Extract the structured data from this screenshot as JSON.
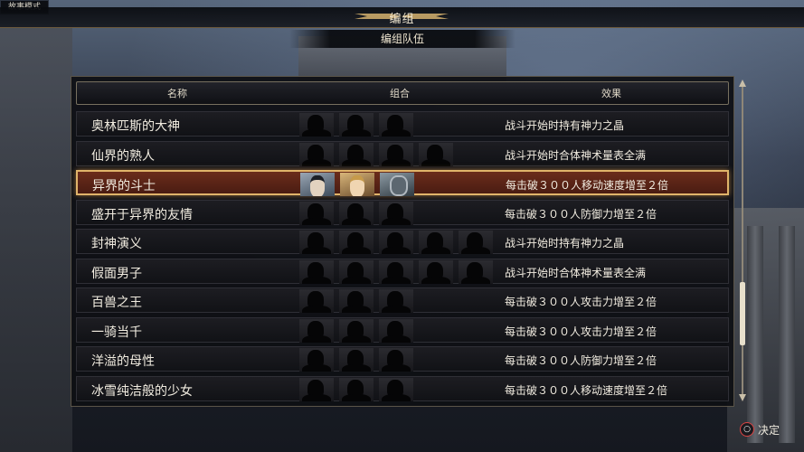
{
  "mode_label": "故事模式",
  "title": "编组",
  "subtitle": "编组队伍",
  "columns": {
    "name": "名称",
    "combo": "组合",
    "effect": "效果"
  },
  "rows": [
    {
      "name": "奥林匹斯的大神",
      "members": 3,
      "effect": "战斗开始时持有神力之晶"
    },
    {
      "name": "仙界的熟人",
      "members": 4,
      "effect": "战斗开始时合体神术量表全满"
    },
    {
      "name": "异界的斗士",
      "members": 3,
      "effect": "每击破３００人移动速度增至２倍",
      "selected": true
    },
    {
      "name": "盛开于异界的友情",
      "members": 3,
      "effect": "每击破３００人防御力增至２倍"
    },
    {
      "name": "封神演义",
      "members": 5,
      "effect": "战斗开始时持有神力之晶"
    },
    {
      "name": "假面男子",
      "members": 5,
      "effect": "战斗开始时合体神术量表全满"
    },
    {
      "name": "百兽之王",
      "members": 3,
      "effect": "每击破３００人攻击力增至２倍"
    },
    {
      "name": "一骑当千",
      "members": 3,
      "effect": "每击破３００人攻击力增至２倍"
    },
    {
      "name": "洋溢的母性",
      "members": 3,
      "effect": "每击破３００人防御力增至２倍"
    },
    {
      "name": "冰雪纯洁般的少女",
      "members": 3,
      "effect": "每击破３００人移动速度增至２倍"
    }
  ],
  "scroll_position": 0.8,
  "confirm": {
    "button": "○",
    "label": "决定"
  },
  "colors": {
    "accent": "#e0b46a",
    "selected_bg": "#5a2316"
  }
}
